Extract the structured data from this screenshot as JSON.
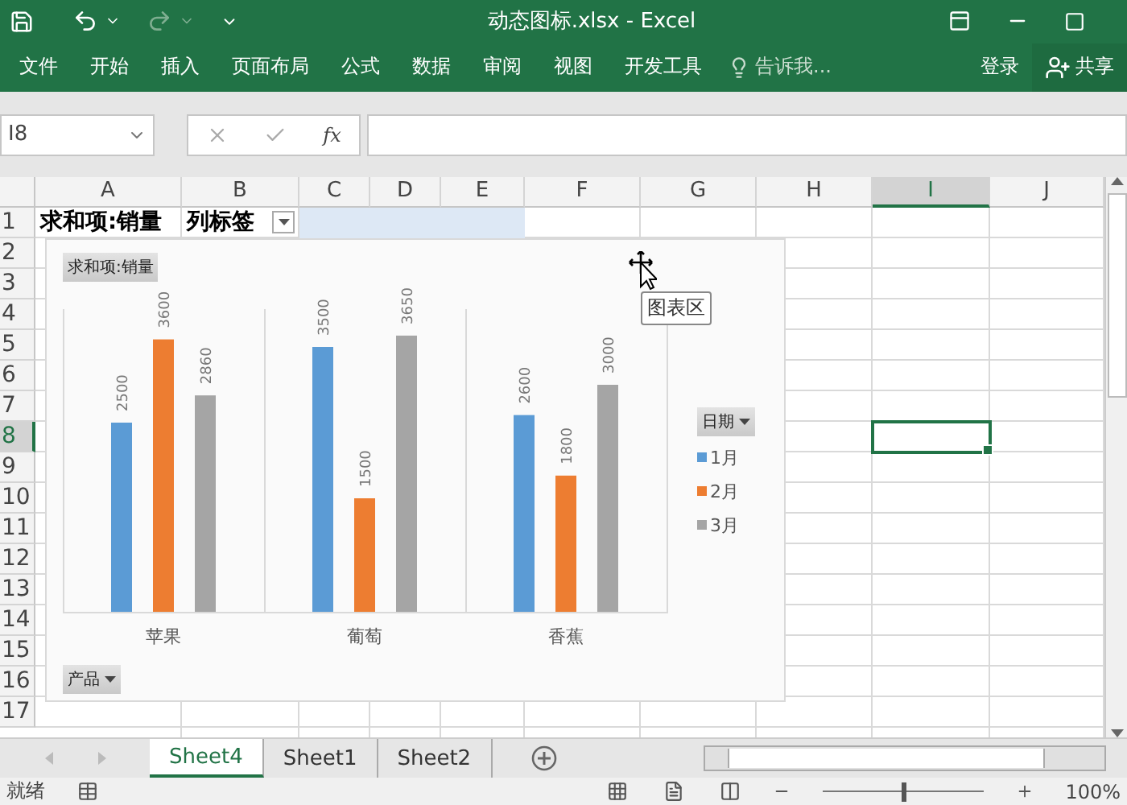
{
  "window": {
    "title": "动态图标.xlsx - Excel"
  },
  "ribbon_tabs": [
    {
      "label": "文件"
    },
    {
      "label": "开始"
    },
    {
      "label": "插入"
    },
    {
      "label": "页面布局"
    },
    {
      "label": "公式"
    },
    {
      "label": "数据"
    },
    {
      "label": "审阅"
    },
    {
      "label": "视图"
    },
    {
      "label": "开发工具"
    }
  ],
  "tell_me": {
    "placeholder": "告诉我..."
  },
  "sign_in": "登录",
  "share": "共享",
  "name_box": {
    "value": "I8"
  },
  "formula_bar": {
    "fx": "fx"
  },
  "columns": [
    {
      "label": "A",
      "selected": false
    },
    {
      "label": "B",
      "selected": false
    },
    {
      "label": "C",
      "selected": false
    },
    {
      "label": "D",
      "selected": false
    },
    {
      "label": "E",
      "selected": false
    },
    {
      "label": "F",
      "selected": false
    },
    {
      "label": "G",
      "selected": false
    },
    {
      "label": "H",
      "selected": false
    },
    {
      "label": "I",
      "selected": true
    },
    {
      "label": "J",
      "selected": false
    }
  ],
  "rows": [
    {
      "label": "1",
      "selected": false
    },
    {
      "label": "2",
      "selected": false
    },
    {
      "label": "3",
      "selected": false
    },
    {
      "label": "4",
      "selected": false
    },
    {
      "label": "5",
      "selected": false
    },
    {
      "label": "6",
      "selected": false
    },
    {
      "label": "7",
      "selected": false
    },
    {
      "label": "8",
      "selected": true
    },
    {
      "label": "9",
      "selected": false
    },
    {
      "label": "10",
      "selected": false
    },
    {
      "label": "11",
      "selected": false
    },
    {
      "label": "12",
      "selected": false
    },
    {
      "label": "13",
      "selected": false
    },
    {
      "label": "14",
      "selected": false
    },
    {
      "label": "15",
      "selected": false
    },
    {
      "label": "16",
      "selected": false
    },
    {
      "label": "17",
      "selected": false
    }
  ],
  "pivot_header": {
    "value_field": "求和项:销量",
    "column_labels": "列标签"
  },
  "chart": {
    "value_field_button": "求和项:销量",
    "axis_field_button": "产品",
    "legend_field_button": "日期",
    "tooltip": "图表区",
    "chart_data": {
      "type": "bar",
      "categories": [
        "苹果",
        "葡萄",
        "香蕉"
      ],
      "ylim": [
        0,
        4000
      ],
      "data_labels": true,
      "series": [
        {
          "name": "1月",
          "color": "#5b9bd5",
          "values": [
            2500,
            3500,
            2600
          ]
        },
        {
          "name": "2月",
          "color": "#ed7d31",
          "values": [
            3600,
            1500,
            1800
          ]
        },
        {
          "name": "3月",
          "color": "#a5a5a5",
          "values": [
            2860,
            3650,
            3000
          ]
        }
      ]
    }
  },
  "sheet_tabs": [
    {
      "label": "Sheet4",
      "selected": true
    },
    {
      "label": "Sheet1",
      "selected": false
    },
    {
      "label": "Sheet2",
      "selected": false
    }
  ],
  "status_bar": {
    "status": "就绪",
    "zoom": "100%",
    "zoom_slider": {
      "level": 0.5
    }
  }
}
